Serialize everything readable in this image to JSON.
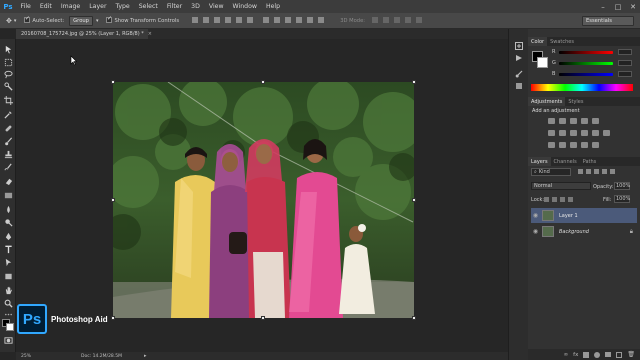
{
  "app": {
    "logo": "Ps"
  },
  "menubar": {
    "items": [
      "File",
      "Edit",
      "Image",
      "Layer",
      "Type",
      "Select",
      "Filter",
      "3D",
      "View",
      "Window",
      "Help"
    ],
    "window_controls": [
      "–",
      "□",
      "✕"
    ]
  },
  "options": {
    "auto_select_label": "Auto-Select:",
    "auto_select_value": "Group",
    "transform_label": "Show Transform Controls",
    "mode_3d": "3D Mode:",
    "workspace": "Essentials"
  },
  "document": {
    "tab_title": "20160708_175724.jpg @ 25% (Layer 1, RGB/8) *",
    "tab_close": "×"
  },
  "status": {
    "zoom": "25%",
    "doc": "Doc: 14.2M/28.5M",
    "arrow": "▸"
  },
  "watermark": {
    "logo": "Ps",
    "text": "Photoshop Aid"
  },
  "color_panel": {
    "tabs": [
      "Color",
      "Swatches"
    ],
    "channels": [
      "R",
      "G",
      "B"
    ]
  },
  "adjustments": {
    "tabs": [
      "Adjustments",
      "Styles"
    ],
    "title": "Add an adjustment"
  },
  "layers": {
    "tabs": [
      "Layers",
      "Channels",
      "Paths"
    ],
    "kind_label": "Kind",
    "blend_mode": "Normal",
    "opacity_label": "Opacity:",
    "opacity_value": "100%",
    "lock_label": "Lock:",
    "fill_label": "Fill:",
    "fill_value": "100%",
    "items": [
      {
        "name": "Layer 1",
        "selected": true
      },
      {
        "name": "Background",
        "selected": false
      }
    ],
    "footer_icons": [
      "link-icon",
      "fx-icon",
      "mask-icon",
      "adjustment-icon",
      "folder-icon",
      "new-layer-icon",
      "trash-icon"
    ]
  },
  "colors": {
    "accent": "#31a8ff",
    "panel_bg": "#323232",
    "selected_layer": "#4b5a7a"
  }
}
